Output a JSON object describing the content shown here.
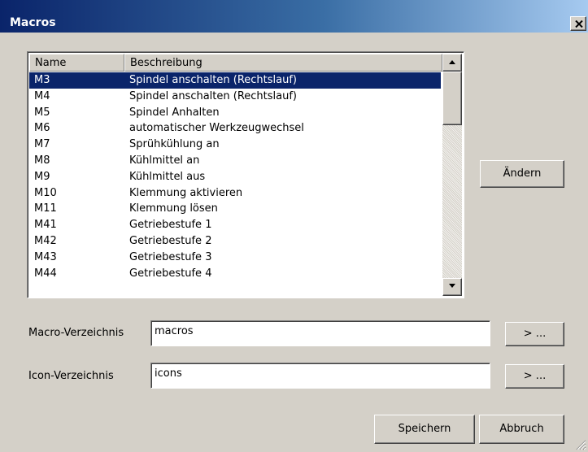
{
  "window": {
    "title": "Macros",
    "close_icon": "close-icon"
  },
  "list": {
    "columns": [
      "Name",
      "Beschreibung"
    ],
    "rows": [
      {
        "name": "M3",
        "description": "Spindel anschalten (Rechtslauf)",
        "selected": true
      },
      {
        "name": "M4",
        "description": "Spindel anschalten (Rechtslauf)",
        "selected": false
      },
      {
        "name": "M5",
        "description": "Spindel Anhalten",
        "selected": false
      },
      {
        "name": "M6",
        "description": "automatischer Werkzeugwechsel",
        "selected": false
      },
      {
        "name": "M7",
        "description": "Sprühkühlung an",
        "selected": false
      },
      {
        "name": "M8",
        "description": "Kühlmittel an",
        "selected": false
      },
      {
        "name": "M9",
        "description": "Kühlmittel aus",
        "selected": false
      },
      {
        "name": "M10",
        "description": "Klemmung aktivieren",
        "selected": false
      },
      {
        "name": "M11",
        "description": "Klemmung lösen",
        "selected": false
      },
      {
        "name": "M41",
        "description": "Getriebestufe 1",
        "selected": false
      },
      {
        "name": "M42",
        "description": "Getriebestufe 2",
        "selected": false
      },
      {
        "name": "M43",
        "description": "Getriebestufe 3",
        "selected": false
      },
      {
        "name": "M44",
        "description": "Getriebestufe 4",
        "selected": false
      }
    ],
    "scroll_up_icon": "arrow-up-icon",
    "scroll_down_icon": "arrow-down-icon"
  },
  "buttons": {
    "edit": "Ändern",
    "browse_macro": "> ...",
    "browse_icon": "> ...",
    "save": "Speichern",
    "cancel": "Abbruch"
  },
  "fields": {
    "macro_dir_label": "Macro-Verzeichnis",
    "macro_dir_value": "macros",
    "icon_dir_label": "Icon-Verzeichnis",
    "icon_dir_value": "icons"
  },
  "colors": {
    "selection": "#0a246a",
    "dialog_background": "#d4d0c8",
    "title_gradient_start": "#0a246a",
    "title_gradient_end": "#a6caf0"
  }
}
